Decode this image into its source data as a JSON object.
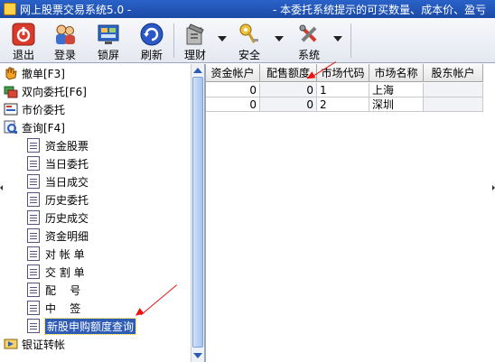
{
  "window": {
    "title": "网上股票交易系统5.0 -",
    "marquee": "- 本委托系统提示的可买数量、成本价、盈亏"
  },
  "toolbar": {
    "buttons": [
      {
        "label": "退出",
        "icon": "power-icon"
      },
      {
        "label": "登录",
        "icon": "users-icon"
      },
      {
        "label": "锁屏",
        "icon": "lock-screen-icon"
      },
      {
        "label": "刷新",
        "icon": "refresh-icon"
      },
      {
        "label": "理财",
        "icon": "finance-icon"
      },
      {
        "label": "安全",
        "icon": "key-icon"
      },
      {
        "label": "系统",
        "icon": "tools-icon"
      }
    ]
  },
  "tree": {
    "items": [
      {
        "label": "撤单[F3]",
        "icon": "hand-icon"
      },
      {
        "label": "双向委托[F6]",
        "icon": "exchange-icon"
      },
      {
        "label": "市价委托",
        "icon": "market-order-icon"
      },
      {
        "label": "查询[F4]",
        "icon": "query-icon"
      },
      {
        "label": "资金股票",
        "icon": "document-icon"
      },
      {
        "label": "当日委托",
        "icon": "document-icon"
      },
      {
        "label": "当日成交",
        "icon": "document-icon"
      },
      {
        "label": "历史委托",
        "icon": "document-icon"
      },
      {
        "label": "历史成交",
        "icon": "document-icon"
      },
      {
        "label": "资金明细",
        "icon": "document-icon"
      },
      {
        "label": "对 帐 单",
        "icon": "document-icon"
      },
      {
        "label": "交 割 单",
        "icon": "document-icon"
      },
      {
        "label": "配    号",
        "icon": "document-icon"
      },
      {
        "label": "中    签",
        "icon": "document-icon"
      },
      {
        "label": "新股申购额度查询",
        "icon": "document-icon"
      },
      {
        "label": "银证转帐",
        "icon": "transfer-icon"
      }
    ],
    "selected": "新股申购额度查询"
  },
  "table": {
    "headers": [
      "资金帐户",
      "配售额度",
      "市场代码",
      "市场名称",
      "股东帐户"
    ],
    "rows": [
      [
        "0",
        "0",
        "1",
        "上海",
        ""
      ],
      [
        "0",
        "0",
        "2",
        "深圳",
        ""
      ]
    ]
  },
  "colors": {
    "titlebar": "#1b4aa6",
    "selection": "#2d5bb5",
    "annotation_arrow": "#e11111"
  }
}
